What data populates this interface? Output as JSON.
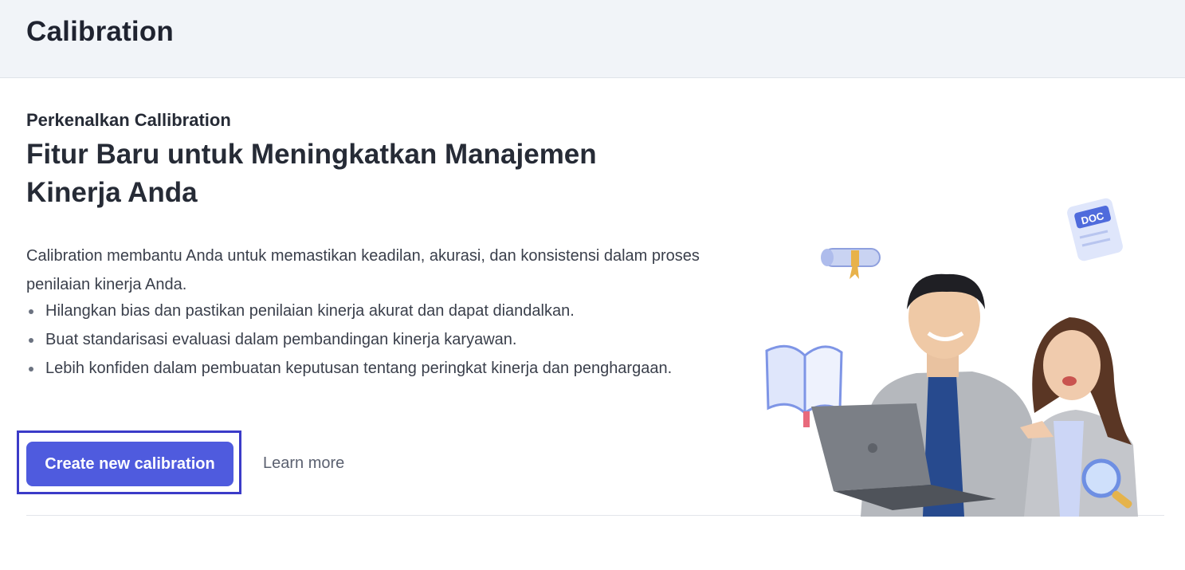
{
  "header": {
    "title": "Calibration"
  },
  "intro": {
    "eyebrow": "Perkenalkan Callibration",
    "headline": "Fitur Baru untuk Meningkatkan Manajemen Kinerja Anda",
    "description": "Calibration membantu Anda untuk memastikan keadilan, akurasi, dan konsistensi dalam proses penilaian kinerja Anda.",
    "bullets": [
      "Hilangkan bias dan pastikan penilaian kinerja akurat dan dapat diandalkan.",
      "Buat standarisasi evaluasi dalam pembandingan kinerja karyawan.",
      "Lebih konfiden dalam pembuatan keputusan tentang peringkat kinerja dan penghargaan."
    ]
  },
  "actions": {
    "create_label": "Create new calibration",
    "learn_more_label": "Learn more"
  },
  "illustration": {
    "doc_badge": "DOC"
  },
  "colors": {
    "primary": "#4f5bde",
    "focus_ring": "#3b3bc8",
    "header_bg": "#f1f4f8"
  }
}
